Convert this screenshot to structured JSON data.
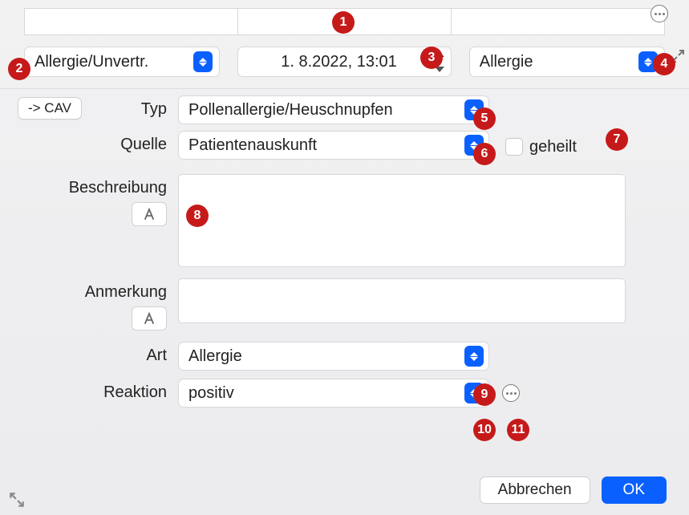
{
  "header": {
    "category_select": "Allergie/Unvertr.",
    "date_value": "1.  8.2022, 13:01",
    "type_select": "Allergie"
  },
  "cav_button": "-> CAV",
  "form": {
    "typ": {
      "label": "Typ",
      "value": "Pollenallergie/Heuschnupfen"
    },
    "quelle": {
      "label": "Quelle",
      "value": "Patientenauskunft"
    },
    "geheilt": {
      "label": "geheilt"
    },
    "beschreibung": {
      "label": "Beschreibung",
      "value": ""
    },
    "anmerkung": {
      "label": "Anmerkung",
      "value": ""
    },
    "art": {
      "label": "Art",
      "value": "Allergie"
    },
    "reaktion": {
      "label": "Reaktion",
      "value": "positiv"
    }
  },
  "footer": {
    "cancel": "Abbrechen",
    "ok": "OK"
  },
  "badges": {
    "b1": "1",
    "b2": "2",
    "b3": "3",
    "b4": "4",
    "b5": "5",
    "b6": "6",
    "b7": "7",
    "b8": "8",
    "b9": "9",
    "b10": "10",
    "b11": "11"
  }
}
